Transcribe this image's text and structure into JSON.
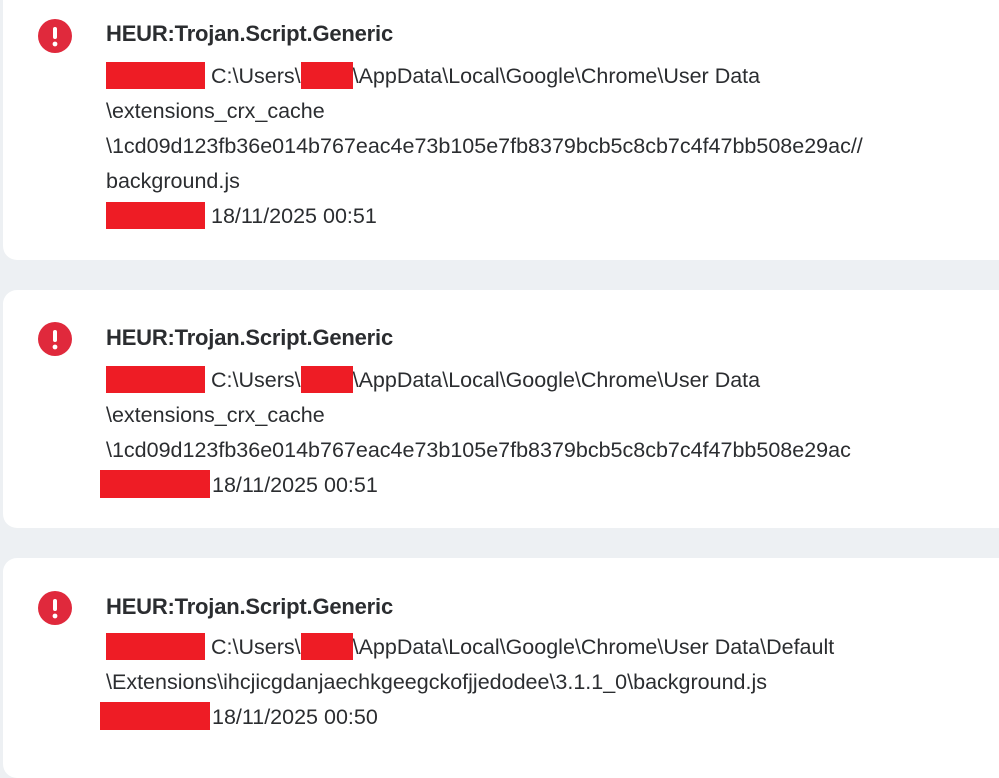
{
  "colors": {
    "page_background": "#edf0f3",
    "card_background": "#ffffff",
    "alert_icon": "#e0293c",
    "redaction": "#ee1c25",
    "text": "#2b2d30"
  },
  "detections": [
    {
      "icon": "exclamation-alert-icon",
      "threat": "HEUR:Trojan.Script.Generic",
      "path_prefix": "C:\\Users\\",
      "path_suffix": "\\AppData\\Local\\Google\\Chrome\\User Data",
      "path_lines": [
        "\\extensions_crx_cache",
        "\\1cd09d123fb36e014b767eac4e73b105e7fb8379bcb5c8cb7c4f47bb508e29ac//",
        "background.js"
      ],
      "datetime": "18/11/2025 00:51"
    },
    {
      "icon": "exclamation-alert-icon",
      "threat": "HEUR:Trojan.Script.Generic",
      "path_prefix": "C:\\Users\\",
      "path_suffix": "\\AppData\\Local\\Google\\Chrome\\User Data",
      "path_lines": [
        "\\extensions_crx_cache",
        "\\1cd09d123fb36e014b767eac4e73b105e7fb8379bcb5c8cb7c4f47bb508e29ac"
      ],
      "datetime": "18/11/2025 00:51"
    },
    {
      "icon": "exclamation-alert-icon",
      "threat": "HEUR:Trojan.Script.Generic",
      "path_prefix": "C:\\Users\\",
      "path_suffix": "\\AppData\\Local\\Google\\Chrome\\User Data\\Default",
      "path_lines": [
        "\\Extensions\\ihcjicgdanjaechkgeegckofjjedodee\\3.1.1_0\\background.js"
      ],
      "datetime": "18/11/2025 00:50"
    }
  ]
}
